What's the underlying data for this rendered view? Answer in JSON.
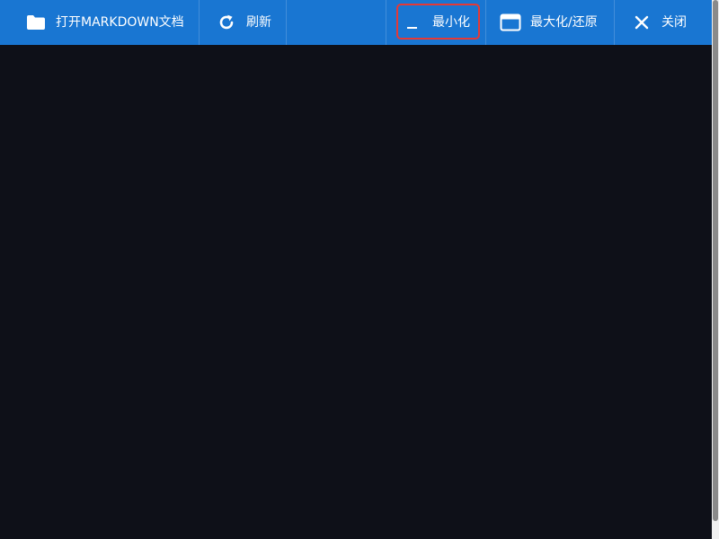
{
  "toolbar": {
    "background": "#1976d2",
    "buttons": {
      "open": {
        "label": "打开MARKDOWN文档",
        "icon": "folder-icon"
      },
      "refresh": {
        "label": "刷新",
        "icon": "refresh-icon"
      },
      "minimize": {
        "label": "最小化",
        "icon": "minimize-icon",
        "highlighted": true,
        "highlight_color": "#e53935"
      },
      "maximize": {
        "label": "最大化/还原",
        "icon": "window-maximize-icon"
      },
      "close": {
        "label": "关闭",
        "icon": "close-icon"
      }
    }
  },
  "content": {
    "background": "#0e1018"
  }
}
